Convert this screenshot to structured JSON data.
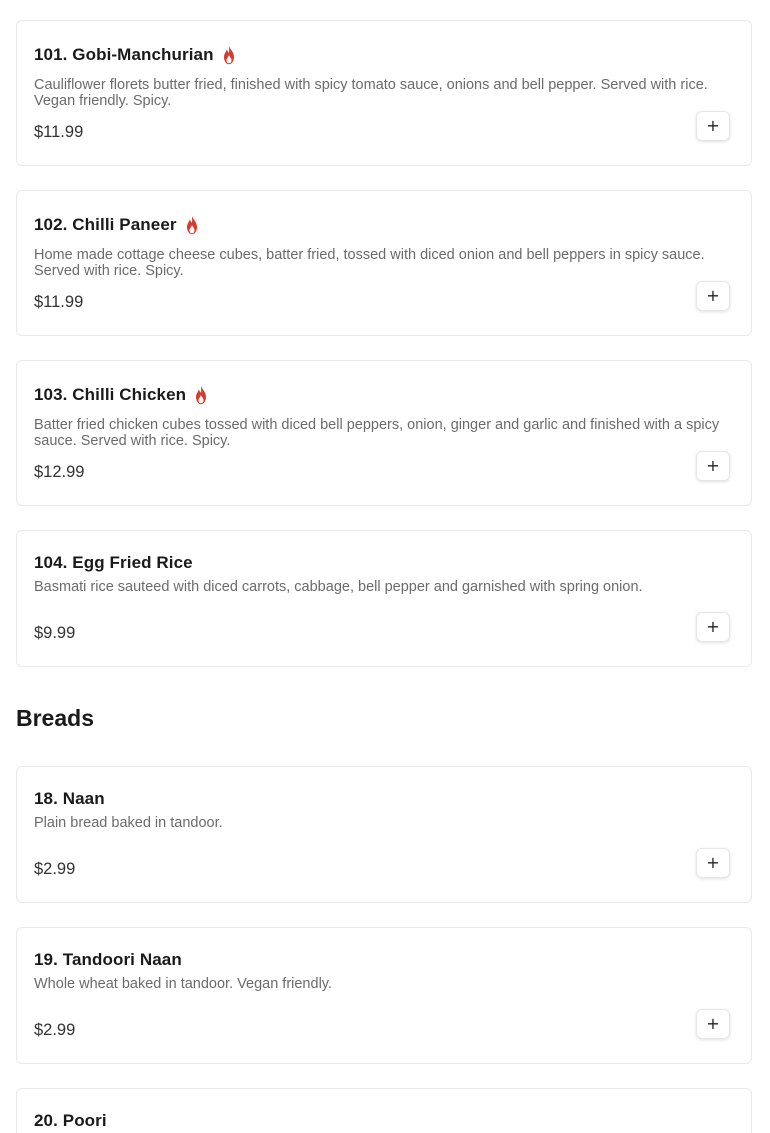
{
  "colors": {
    "flame": "#d63b2f",
    "text": "#1a1a1a",
    "muted": "#6b6b6b",
    "border": "#e9e9e9"
  },
  "items": [
    {
      "title": "101. Gobi-Manchurian",
      "spicy": true,
      "description": "Cauliflower florets butter fried, finished with spicy tomato sauce, onions and bell pepper. Served with rice. Vegan friendly. Spicy.",
      "price": "$11.99",
      "add_icon": "plus-icon"
    },
    {
      "title": "102. Chilli Paneer",
      "spicy": true,
      "description": "Home made cottage cheese cubes, batter fried, tossed with diced onion and bell peppers in spicy sauce. Served with rice. Spicy.",
      "price": "$11.99",
      "add_icon": "plus-icon"
    },
    {
      "title": "103. Chilli Chicken",
      "spicy": true,
      "description": "Batter fried chicken cubes tossed with diced bell peppers, onion, ginger and garlic and finished with a spicy sauce. Served with rice. Spicy.",
      "price": "$12.99",
      "add_icon": "plus-icon"
    },
    {
      "title": "104. Egg Fried Rice",
      "spicy": false,
      "description": "Basmati rice sauteed with diced carrots, cabbage, bell pepper and garnished with spring onion.",
      "price": "$9.99",
      "add_icon": "plus-icon"
    }
  ],
  "breads_section": {
    "title": "Breads",
    "items": [
      {
        "title": "18. Naan",
        "description": "Plain bread baked in tandoor.",
        "price": "$2.99",
        "add_icon": "plus-icon"
      },
      {
        "title": "19. Tandoori Naan",
        "description": "Whole wheat baked in tandoor. Vegan friendly.",
        "price": "$2.99",
        "add_icon": "plus-icon"
      },
      {
        "title": "20. Poori"
      }
    ]
  },
  "add_button_glyph": "+"
}
